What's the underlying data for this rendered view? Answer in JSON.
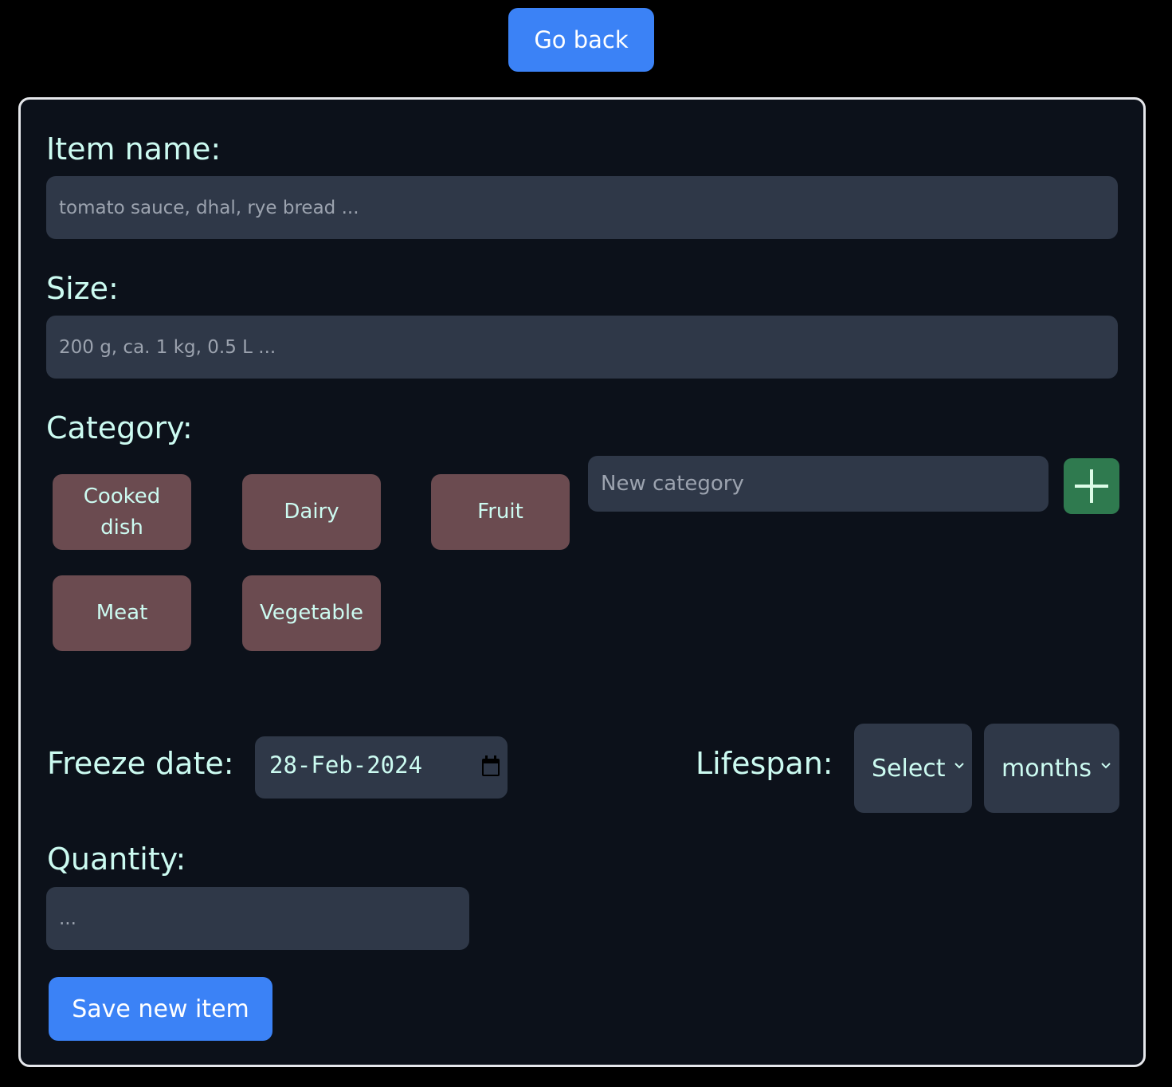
{
  "header": {
    "go_back_label": "Go back"
  },
  "form": {
    "item_name": {
      "label": "Item name:",
      "placeholder": "tomato sauce, dhal, rye bread ..."
    },
    "size": {
      "label": "Size:",
      "placeholder": "200 g, ca. 1 kg, 0.5 L ..."
    },
    "category": {
      "label": "Category:",
      "options": [
        {
          "label": "Cooked dish"
        },
        {
          "label": "Dairy"
        },
        {
          "label": "Fruit"
        },
        {
          "label": "Meat"
        },
        {
          "label": "Vegetable"
        }
      ],
      "new_placeholder": "New category",
      "add_icon": "plus-icon"
    },
    "freeze_date": {
      "label": "Freeze date:",
      "value": "28-Feb-2024",
      "icon": "calendar-icon"
    },
    "lifespan": {
      "label": "Lifespan:",
      "amount_selected": "Select",
      "unit_selected": "months",
      "icon": "chevron-down-icon"
    },
    "quantity": {
      "label": "Quantity:",
      "placeholder": "..."
    },
    "save_label": "Save new item"
  },
  "colors": {
    "background": "#000000",
    "card": "#0c111a",
    "input": "#2f3848",
    "chip": "#6b4b50",
    "primary": "#3b82f6",
    "add": "#2f7a4f",
    "label_text": "#ccfbf1"
  }
}
